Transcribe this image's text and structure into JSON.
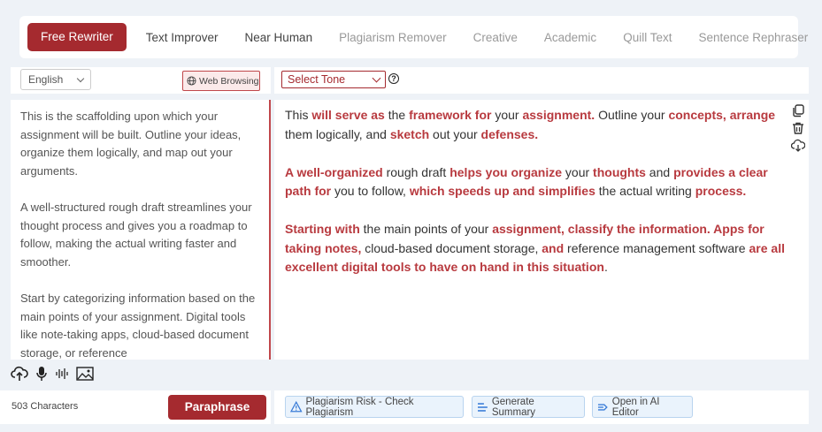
{
  "modes": [
    {
      "label": "Free Rewriter",
      "state": "active"
    },
    {
      "label": "Text Improver",
      "state": "dark"
    },
    {
      "label": "Near Human",
      "state": "dark"
    },
    {
      "label": "Plagiarism Remover",
      "state": "muted"
    },
    {
      "label": "Creative",
      "state": "muted"
    },
    {
      "label": "Academic",
      "state": "muted"
    },
    {
      "label": "Quill Text",
      "state": "muted"
    },
    {
      "label": "Sentence Rephraser",
      "state": "muted"
    }
  ],
  "input": {
    "language": "English",
    "web_browsing": "Web Browsing",
    "paragraphs": [
      "This is the scaffolding upon which your assignment will be built. Outline your ideas, organize them logically, and map out your arguments.",
      "A well-structured rough draft streamlines your thought process and gives you a roadmap to follow, making the actual writing faster and smoother.",
      "Start by categorizing information based on the main points of your assignment. Digital tools like note-taking apps, cloud-based document storage, or reference"
    ]
  },
  "output": {
    "tone": "Select Tone",
    "help": "?",
    "paragraphs": [
      [
        {
          "t": "This "
        },
        {
          "t": "will serve as",
          "h": 1
        },
        {
          "t": " the "
        },
        {
          "t": "framework for",
          "h": 1
        },
        {
          "t": " your "
        },
        {
          "t": "assignment.",
          "h": 1
        },
        {
          "t": " Outline your "
        },
        {
          "t": "concepts, arrange",
          "h": 1
        },
        {
          "t": " them logically, and "
        },
        {
          "t": "sketch",
          "h": 1
        },
        {
          "t": " out your "
        },
        {
          "t": "defenses.",
          "h": 1
        }
      ],
      [
        {
          "t": "A well-organized",
          "h": 1
        },
        {
          "t": " rough draft "
        },
        {
          "t": "helps you organize",
          "h": 1
        },
        {
          "t": " your "
        },
        {
          "t": "thoughts",
          "h": 1
        },
        {
          "t": " and "
        },
        {
          "t": "provides a clear path for",
          "h": 1
        },
        {
          "t": " you to follow, "
        },
        {
          "t": "which speeds up and simplifies",
          "h": 1
        },
        {
          "t": " the actual writing "
        },
        {
          "t": "process.",
          "h": 1
        }
      ],
      [
        {
          "t": "Starting with",
          "h": 1
        },
        {
          "t": " the main points of your "
        },
        {
          "t": "assignment, classify the information. Apps for taking notes,",
          "h": 1
        },
        {
          "t": " cloud-based document storage, "
        },
        {
          "t": "and",
          "h": 1
        },
        {
          "t": " reference management software "
        },
        {
          "t": "are all excellent digital tools to have on hand in this situation",
          "h": 1
        },
        {
          "t": "."
        }
      ]
    ]
  },
  "footer": {
    "char_count": "503 Characters",
    "paraphrase": "Paraphrase",
    "plagiarism": "Plagiarism Risk - Check Plagiarism",
    "summary": "Generate Summary",
    "ai_editor": "Open in AI Editor"
  }
}
